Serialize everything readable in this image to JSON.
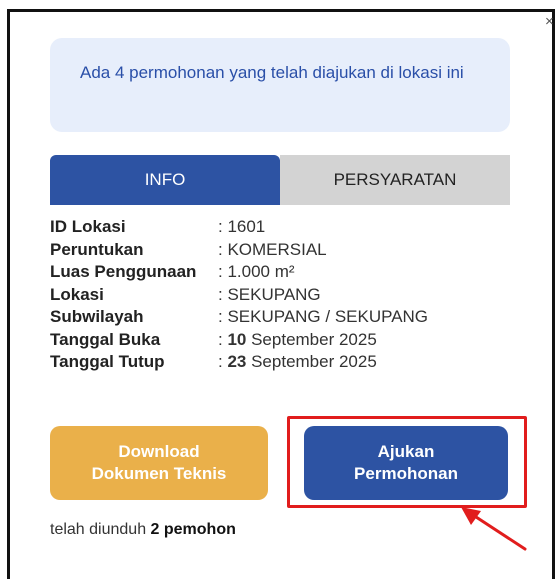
{
  "notice": {
    "text": "Ada 4 permohonan yang telah diajukan di lokasi ini"
  },
  "close_label": "×",
  "tabs": [
    {
      "label": "INFO",
      "active": true
    },
    {
      "label": "PERSYARATAN",
      "active": false
    }
  ],
  "info": {
    "id_lokasi": {
      "label": "ID Lokasi",
      "value": ": 1601"
    },
    "peruntukan": {
      "label": "Peruntukan",
      "value": ": KOMERSIAL"
    },
    "luas": {
      "label": "Luas Penggunaan",
      "value": ": 1.000 m²"
    },
    "lokasi": {
      "label": "Lokasi",
      "value": ": SEKUPANG"
    },
    "subwilayah": {
      "label": "Subwilayah",
      "value": ": SEKUPANG / SEKUPANG"
    },
    "tanggal_buka": {
      "label": "Tanggal Buka",
      "prefix": ": ",
      "day": "10",
      "rest": " September 2025"
    },
    "tanggal_tutup": {
      "label": "Tanggal Tutup",
      "prefix": ": ",
      "day": "23",
      "rest": " September 2025"
    }
  },
  "buttons": {
    "download": {
      "line1": "Download",
      "line2": "Dokumen Teknis"
    },
    "ajukan": {
      "line1": "Ajukan",
      "line2": "Permohonan"
    }
  },
  "footer": {
    "prefix": "telah diunduh ",
    "count": "2 pemohon"
  },
  "colors": {
    "primary": "#2d53a3",
    "download": "#eab04a",
    "highlight": "#e11d1d",
    "notice_bg": "#e7eefb"
  }
}
